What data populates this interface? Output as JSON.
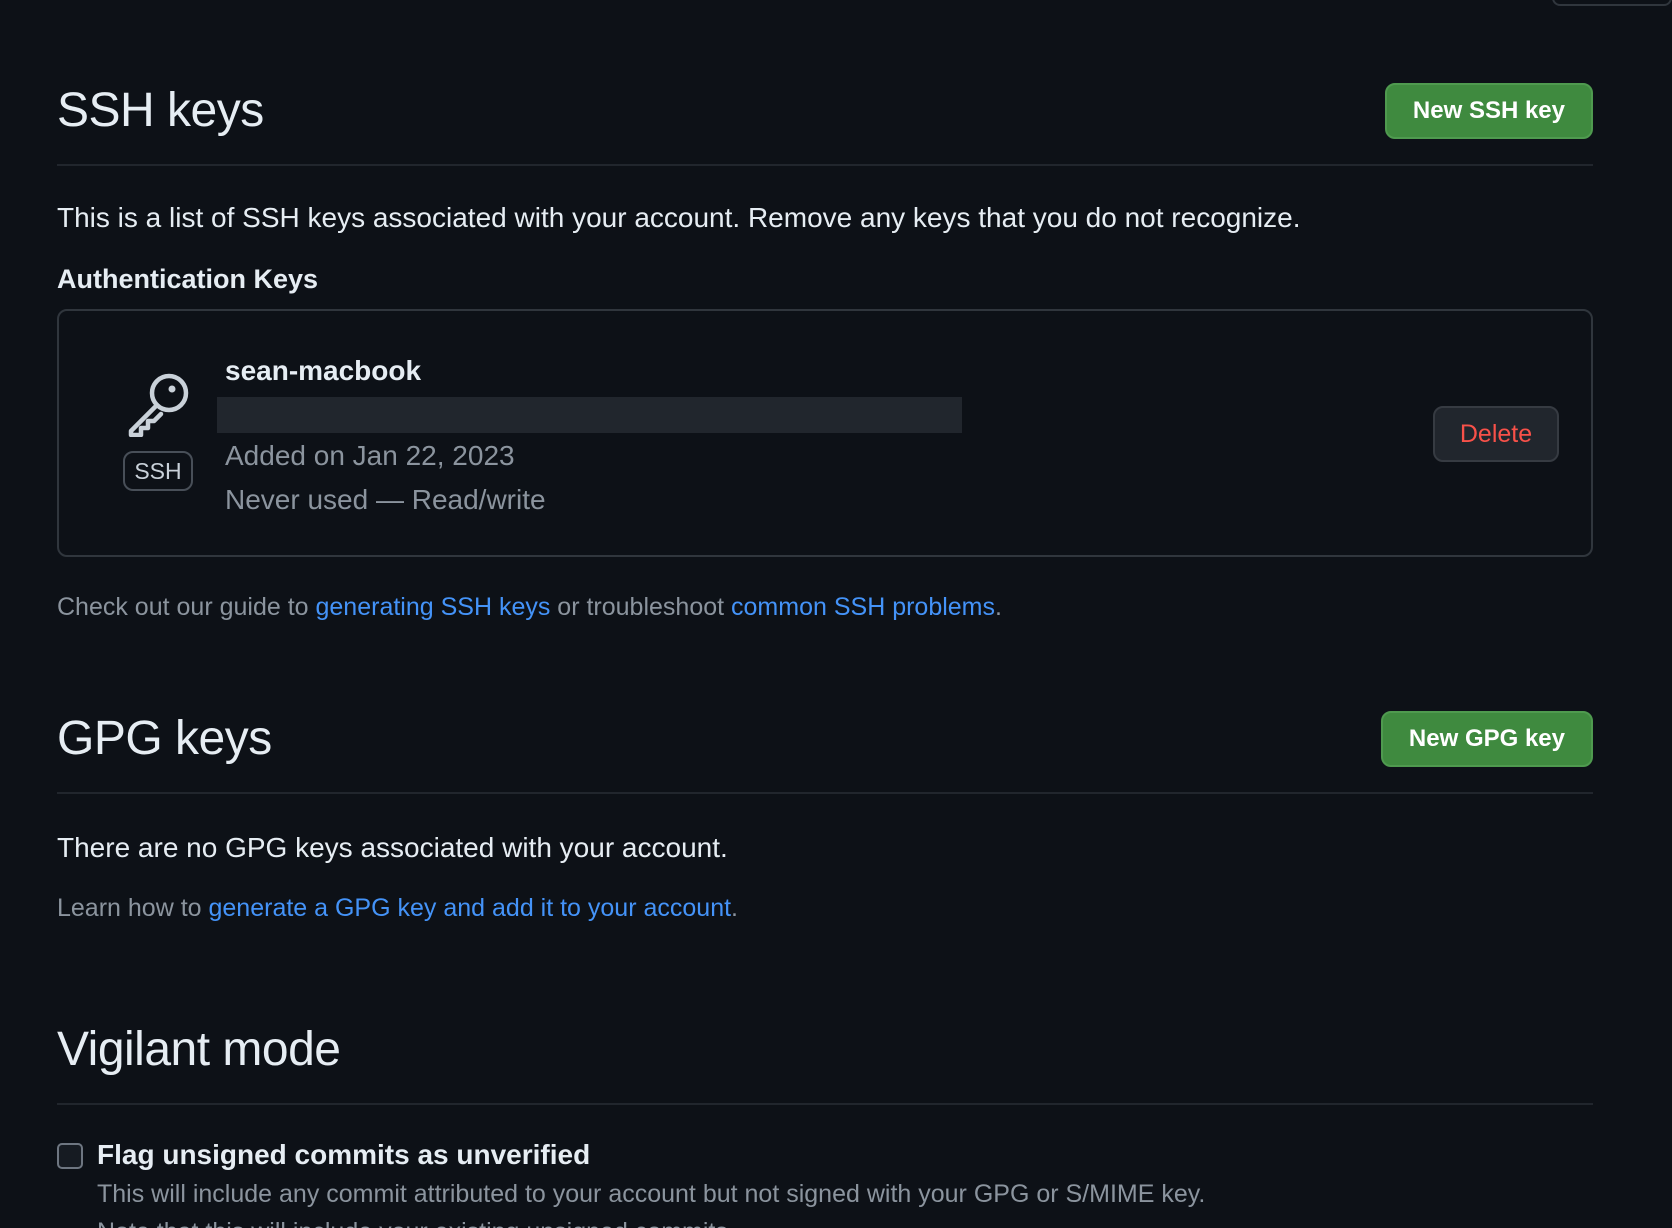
{
  "ssh": {
    "title": "SSH keys",
    "new_button": "New SSH key",
    "description": "This is a list of SSH keys associated with your account. Remove any keys that you do not recognize.",
    "subheading": "Authentication Keys",
    "keys": [
      {
        "icon": "key-icon",
        "badge": "SSH",
        "name": "sean-macbook",
        "added": "Added on Jan 22, 2023",
        "usage": "Never used — Read/write",
        "delete_label": "Delete"
      }
    ],
    "guide": {
      "prefix": "Check out our guide to ",
      "link1": "generating SSH keys",
      "middle": " or troubleshoot ",
      "link2": "common SSH problems",
      "suffix": "."
    }
  },
  "gpg": {
    "title": "GPG keys",
    "new_button": "New GPG key",
    "empty_text": "There are no GPG keys associated with your account.",
    "learn": {
      "prefix": "Learn how to ",
      "link": "generate a GPG key and add it to your account",
      "suffix": "."
    }
  },
  "vigilant": {
    "title": "Vigilant mode",
    "checkbox_checked": false,
    "checkbox_label": "Flag unsigned commits as unverified",
    "checkbox_desc_line1": "This will include any commit attributed to your account but not signed with your GPG or S/MIME key.",
    "checkbox_desc_line2": "Note that this will include your existing unsigned commits."
  },
  "colors": {
    "background": "#0d1117",
    "primary_button": "#3f8a3f",
    "danger_text": "#f85149",
    "link": "#4493f8",
    "muted_text": "#8b949e"
  }
}
